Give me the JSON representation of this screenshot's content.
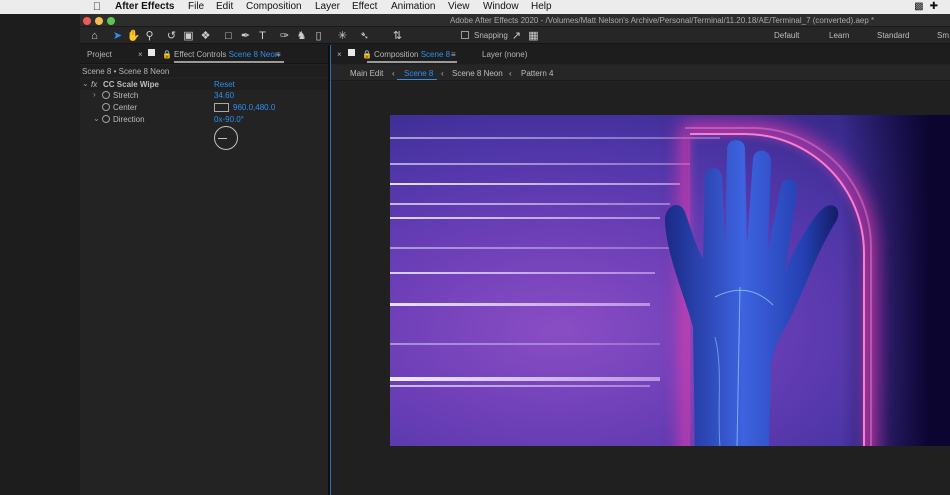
{
  "menubar": {
    "app_name": "After Effects",
    "items": [
      "File",
      "Edit",
      "Composition",
      "Layer",
      "Effect",
      "Animation",
      "View",
      "Window",
      "Help"
    ],
    "apple_icon": "apple-icon"
  },
  "window": {
    "title": "Adobe After Effects 2020 - /Volumes/Matt Nelson's Archive/Personal/Terminal/11.20.18/AE/Terminal_7 (converted).aep *"
  },
  "toolbar": {
    "snapping_label": "Snapping",
    "workspaces": [
      "Default",
      "Learn",
      "Standard",
      "Sm"
    ]
  },
  "left_panel": {
    "tab_project": "Project",
    "tab_effect_controls": "Effect Controls",
    "tab_effect_controls_layer": "Scene 8 Neon",
    "breadcrumb": "Scene 8 • Scene 8 Neon",
    "effect": {
      "fx_label": "fx",
      "name": "CC Scale Wipe",
      "reset_label": "Reset",
      "properties": [
        {
          "name": "Stretch",
          "value": "34.60"
        },
        {
          "name": "Center",
          "value": "960.0,480.0"
        },
        {
          "name": "Direction",
          "value": "0x-90.0°"
        }
      ]
    }
  },
  "composition_panel": {
    "tab_composition": "Composition",
    "tab_composition_name": "Scene 8",
    "tab_layer": "Layer (none)",
    "nav": [
      "Main Edit",
      "Scene 8",
      "Scene 8 Neon",
      "Pattern 4"
    ],
    "active_nav": "Scene 8"
  },
  "colors": {
    "accent": "#2e8ff0",
    "menubar": "#ececec",
    "panel_bg": "#232323",
    "neon_pink": "#ff7fd0"
  }
}
